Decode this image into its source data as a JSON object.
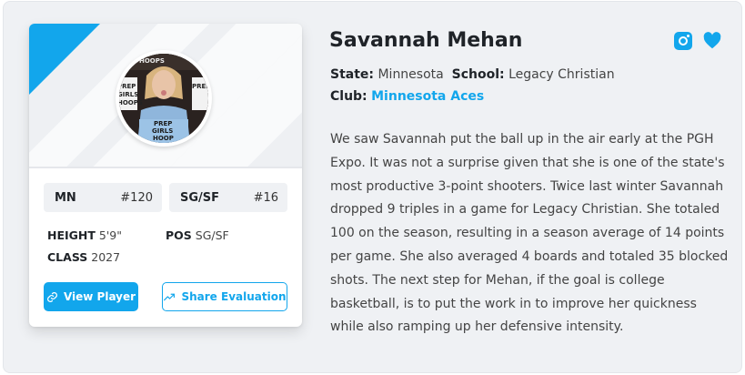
{
  "player": {
    "name": "Savannah Mehan",
    "state_label": "State:",
    "state": "Minnesota",
    "school_label": "School:",
    "school": "Legacy Christian",
    "club_label": "Club:",
    "club": "Minnesota Aces"
  },
  "rankings": [
    {
      "label": "MN",
      "value": "#120"
    },
    {
      "label": "SG/SF",
      "value": "#16"
    }
  ],
  "attributes": {
    "height_label": "HEIGHT",
    "height": "5'9\"",
    "pos_label": "POS",
    "pos": "SG/SF",
    "class_label": "CLASS",
    "class": "2027"
  },
  "actions": {
    "view_player": "View Player",
    "share_evaluation": "Share Evaluation"
  },
  "bio": "We saw Savannah put the ball up in the air early at the PGH Expo. It was not a surprise given that she is one of the state's most productive 3-point shooters. Twice last winter Savannah dropped 9 triples in a game for Legacy Christian. She totaled 100 on the season, resulting in a season average of 14 points per game. She also averaged 4 boards and totaled 35 blocked shots. The next step for Mehan, if the goal is college basketball, is to put the work in to improve her quickness while also ramping up her defensive intensity.",
  "photo_text": {
    "hat": "HOOPS",
    "sign": [
      "PREP",
      "GIRLS",
      "HOOPS"
    ],
    "shirt": [
      "PREP",
      "GIRLS",
      "HOOP"
    ]
  },
  "colors": {
    "accent": "#12a6ec",
    "background": "#eff1f4",
    "card": "#ffffff"
  },
  "icons": [
    "instagram-icon",
    "heart-icon",
    "link-icon",
    "trending-up-icon"
  ]
}
